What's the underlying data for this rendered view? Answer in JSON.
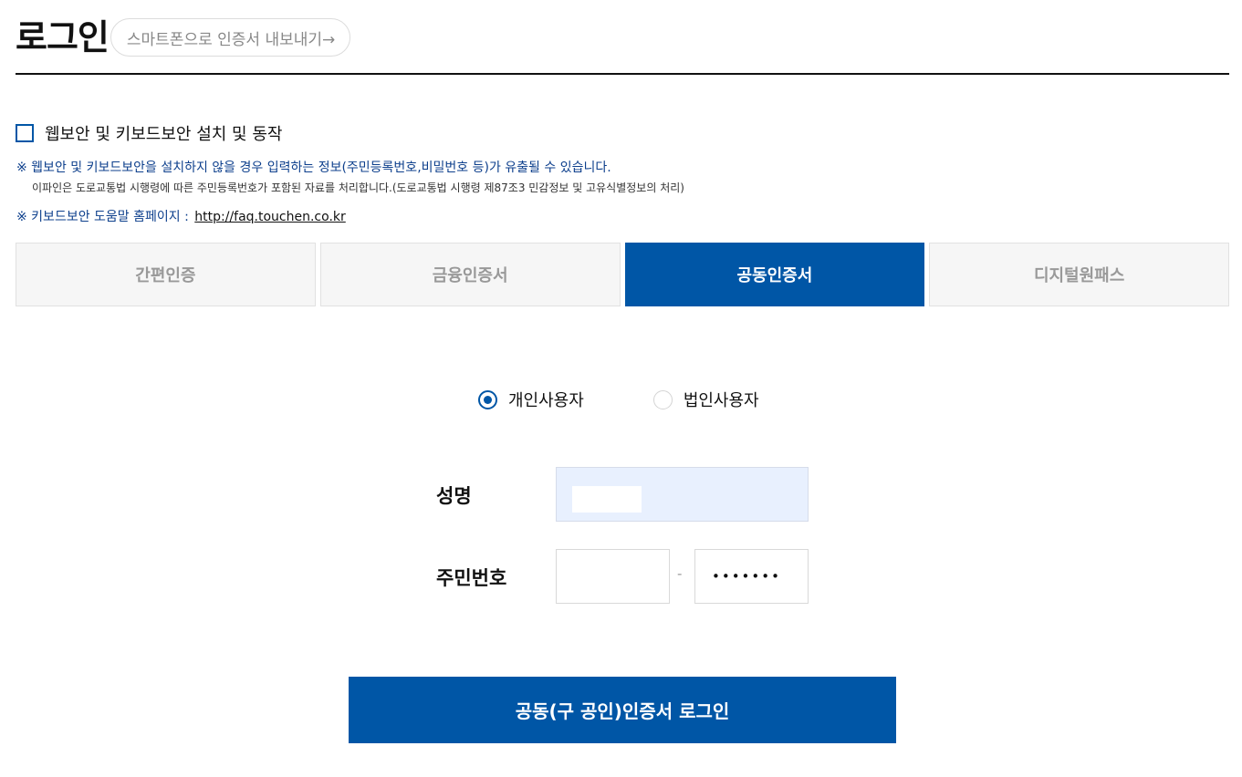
{
  "header": {
    "title": "로그인",
    "export_button": "스마트폰으로 인증서 내보내기→"
  },
  "consent": {
    "label": "웹보안 및 키보드보안 설치 및 동작",
    "checked": false
  },
  "notices": {
    "warning": "※ 웹보안 및 키보드보안을 설치하지 않을 경우 입력하는 정보(주민등록번호,비밀번호 등)가 유출될 수 있습니다.",
    "legal": "이파인은 도로교통법 시행령에 따른 주민등록번호가 포함된 자료를 처리합니다.(도로교통법 시행령 제87조3 민감정보 및 고유식별정보의 처리)",
    "help_prefix": "※ 키보드보안 도움말 홈페이지 :",
    "help_link": "http://faq.touchen.co.kr"
  },
  "tabs": [
    {
      "label": "간편인증",
      "active": false
    },
    {
      "label": "금융인증서",
      "active": false
    },
    {
      "label": "공동인증서",
      "active": true
    },
    {
      "label": "디지털원패스",
      "active": false
    }
  ],
  "user_type": {
    "options": [
      {
        "label": "개인사용자",
        "selected": true
      },
      {
        "label": "법인사용자",
        "selected": false
      }
    ]
  },
  "form": {
    "name_label": "성명",
    "rrn_label": "주민번호",
    "rrn_separator": "-",
    "rrn_back_masked": "•••••••"
  },
  "login_button": "공동(구 공인)인증서 로그인",
  "colors": {
    "primary": "#0056a6",
    "notice_text": "#0d3f8c",
    "tab_inactive_bg": "#f6f6f6",
    "autofill_bg": "#e8f0fe"
  }
}
